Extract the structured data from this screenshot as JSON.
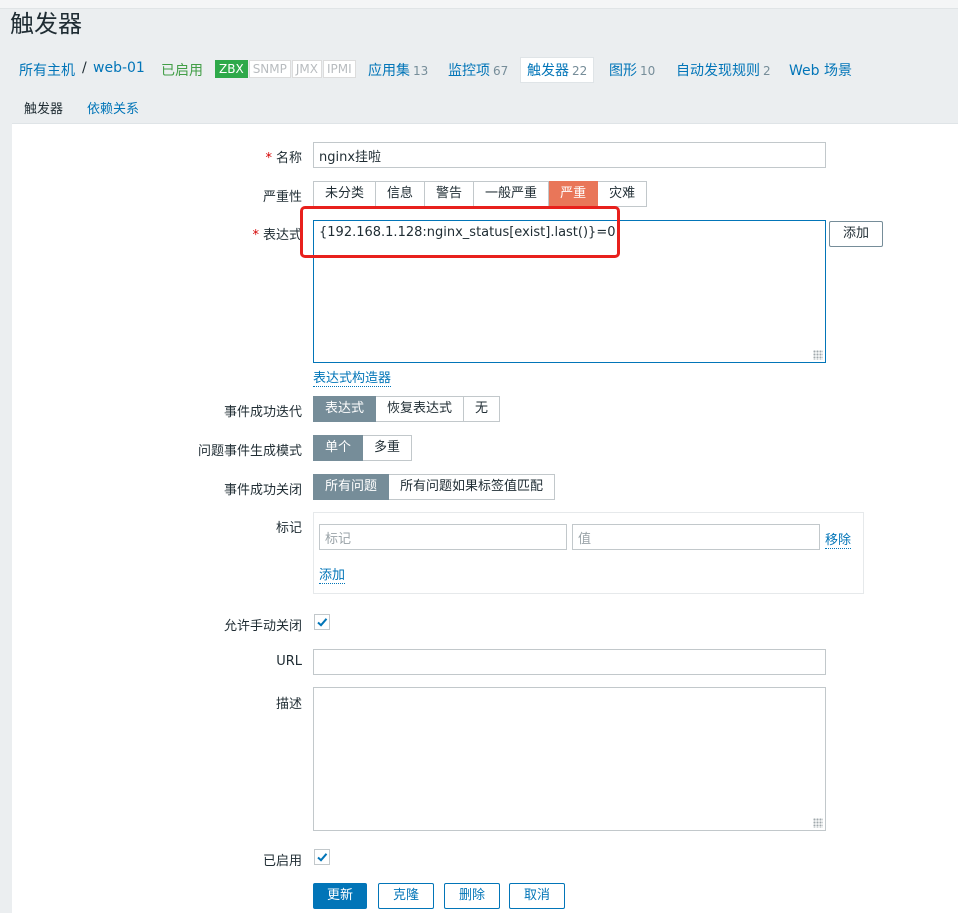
{
  "page": {
    "title": "触发器"
  },
  "hostnav": {
    "all_hosts": "所有主机",
    "separator": "/",
    "host": "web-01",
    "status": "已启用",
    "badges": [
      {
        "label": "ZBX",
        "active": true
      },
      {
        "label": "SNMP",
        "active": false
      },
      {
        "label": "JMX",
        "active": false
      },
      {
        "label": "IPMI",
        "active": false
      }
    ],
    "links": [
      {
        "label": "应用集",
        "count": "13"
      },
      {
        "label": "监控项",
        "count": "67"
      },
      {
        "label": "触发器",
        "count": "22"
      },
      {
        "label": "图形",
        "count": "10"
      },
      {
        "label": "自动发现规则",
        "count": "2"
      },
      {
        "label": "Web 场景",
        "count": ""
      }
    ]
  },
  "tabs": {
    "trigger": "触发器",
    "dependencies": "依赖关系"
  },
  "form": {
    "required_mark": "*",
    "name": {
      "label": "名称",
      "value": "nginx挂啦"
    },
    "severity": {
      "label": "严重性",
      "options": [
        "未分类",
        "信息",
        "警告",
        "一般严重",
        "严重",
        "灾难"
      ],
      "selected": "严重"
    },
    "expression": {
      "label": "表达式",
      "value": "{192.168.1.128:nginx_status[exist].last()}=0",
      "add_button": "添加",
      "constructor_link": "表达式构造器"
    },
    "ok_event_generation": {
      "label": "事件成功迭代",
      "options": [
        "表达式",
        "恢复表达式",
        "无"
      ],
      "selected": "表达式"
    },
    "problem_event_mode": {
      "label": "问题事件生成模式",
      "options": [
        "单个",
        "多重"
      ],
      "selected": "单个"
    },
    "ok_event_closes": {
      "label": "事件成功关闭",
      "options": [
        "所有问题",
        "所有问题如果标签值匹配"
      ],
      "selected": "所有问题"
    },
    "tags": {
      "label": "标记",
      "tag_placeholder": "标记",
      "value_placeholder": "值",
      "remove_link": "移除",
      "add_link": "添加"
    },
    "allow_manual_close": {
      "label": "允许手动关闭",
      "checked": true
    },
    "url": {
      "label": "URL",
      "value": ""
    },
    "description": {
      "label": "描述",
      "value": ""
    },
    "enabled": {
      "label": "已启用",
      "checked": true
    },
    "buttons": {
      "update": "更新",
      "clone": "克隆",
      "delete": "删除",
      "cancel": "取消"
    }
  },
  "colors": {
    "accent": "#0275b8",
    "severity_high": "#e97659",
    "selected_segment": "#768d99",
    "annotation_box": "#e8201c",
    "enabled_green": "#429e47"
  }
}
